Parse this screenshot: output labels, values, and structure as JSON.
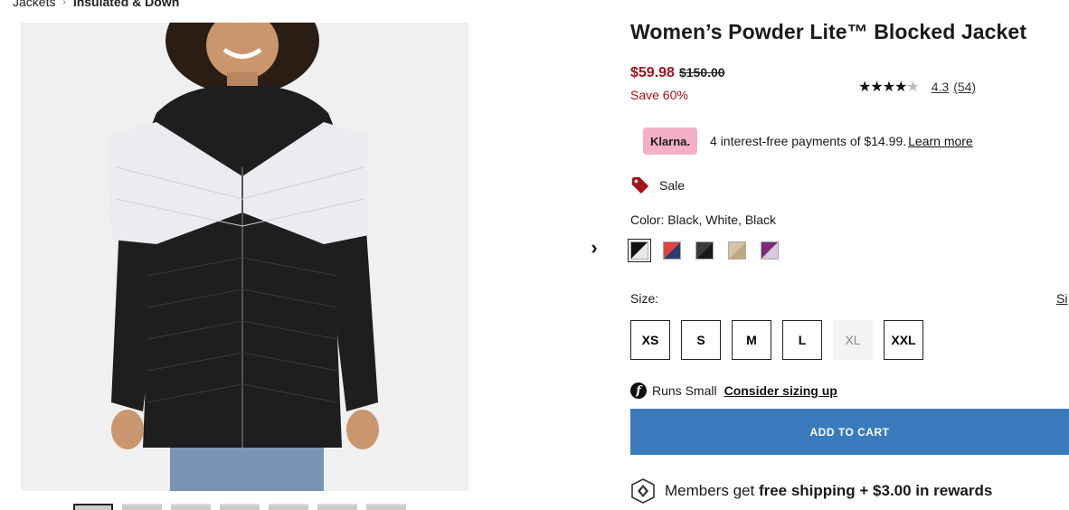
{
  "breadcrumb": {
    "parent": "Jackets",
    "separator": "›",
    "current": "Insulated & Down"
  },
  "product": {
    "title": "Women’s Powder Lite™ Blocked Jacket",
    "sale_price": "$59.98",
    "original_price": "$150.00",
    "save_text": "Save 60%",
    "rating": {
      "stars_filled": "★★★★",
      "stars_half": "★",
      "value": "4.3",
      "count": "(54)"
    },
    "next_arrow": "›"
  },
  "klarna": {
    "badge": "Klarna.",
    "text": "4 interest-free payments of $14.99.",
    "link": "Learn more"
  },
  "sale_tag": {
    "label": "Sale",
    "icon": "price-tag-icon",
    "color": "#a3141b"
  },
  "color": {
    "label": "Color: Black, White, Black",
    "swatches": [
      {
        "name": "black-white",
        "a": "#111111",
        "b": "#e8e8e8",
        "selected": true
      },
      {
        "name": "red-navy",
        "a": "#e0443a",
        "b": "#2f3b6b",
        "selected": false
      },
      {
        "name": "black",
        "a": "#3a3a3a",
        "b": "#1a1a1a",
        "selected": false
      },
      {
        "name": "tan",
        "a": "#d6c4a8",
        "b": "#c2a880",
        "selected": false
      },
      {
        "name": "purple",
        "a": "#7a2c74",
        "b": "#d9c9dc",
        "selected": false
      }
    ]
  },
  "size": {
    "label": "Size:",
    "guide_link": "Si",
    "options": [
      {
        "label": "XS",
        "available": true
      },
      {
        "label": "S",
        "available": true
      },
      {
        "label": "M",
        "available": true
      },
      {
        "label": "L",
        "available": true
      },
      {
        "label": "XL",
        "available": false
      },
      {
        "label": "XXL",
        "available": true
      }
    ]
  },
  "fit": {
    "icon": "f",
    "text": "Runs Small",
    "link": "Consider sizing up"
  },
  "cart": {
    "button_label": "ADD TO CART",
    "color": "#3a7bbd"
  },
  "members": {
    "prefix": "Members get",
    "bold": "free shipping + $3.00 in rewards"
  }
}
